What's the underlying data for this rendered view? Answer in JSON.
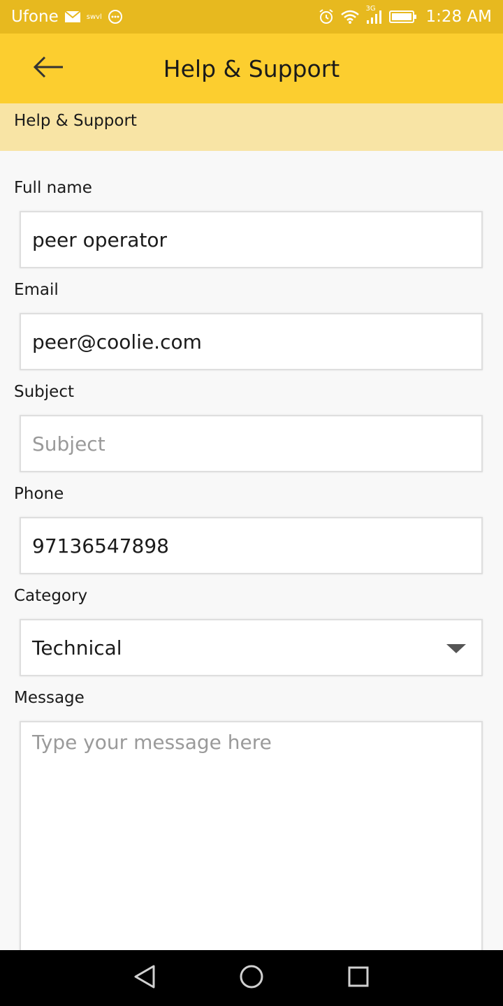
{
  "status_bar": {
    "carrier": "Ufone",
    "small_label": "swvl",
    "time": "1:28 AM",
    "network": "3G",
    "icons": [
      "mail-icon",
      "message-icon",
      "alarm-icon",
      "wifi-icon",
      "signal-icon",
      "battery-icon"
    ]
  },
  "app_bar": {
    "title": "Help & Support",
    "back_icon": "arrow-left-icon"
  },
  "section": {
    "title": "Help & Support"
  },
  "form": {
    "full_name": {
      "label": "Full name",
      "value": "peer operator"
    },
    "email": {
      "label": "Email",
      "value": "peer@coolie.com"
    },
    "subject": {
      "label": "Subject",
      "placeholder": "Subject"
    },
    "phone": {
      "label": "Phone",
      "value": "97136547898"
    },
    "category": {
      "label": "Category",
      "value": "Technical"
    },
    "message": {
      "label": "Message",
      "placeholder": "Type your message here"
    }
  },
  "colors": {
    "status_bar": "#e7b91f",
    "app_bar": "#fcce2f",
    "section_header": "#f8e4a5"
  },
  "nav": {
    "icons": [
      "back-triangle-icon",
      "home-circle-icon",
      "recents-square-icon"
    ]
  }
}
